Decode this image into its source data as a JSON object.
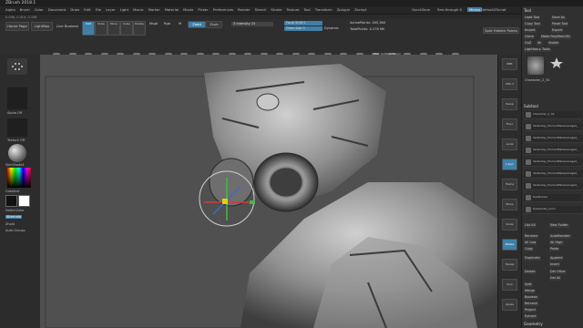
{
  "app": {
    "title": "ZBrush 2018.1"
  },
  "menu": [
    "Alpha",
    "Brush",
    "Color",
    "Document",
    "Draw",
    "Edit",
    "File",
    "Layer",
    "Light",
    "Macro",
    "Marker",
    "Material",
    "Movie",
    "Picker",
    "Preferences",
    "Render",
    "Stencil",
    "Stroke",
    "Texture",
    "Tool",
    "Transform",
    "Zplugin",
    "Zscript"
  ],
  "quick": {
    "quicksave": "QuickSave",
    "seethrough": "See-through 0",
    "menus": "Menus",
    "defaultscript": "DefaultZScript"
  },
  "status": "0.056, 0.414, 0.108",
  "toolbar": {
    "homepage": "Home Page",
    "lightbox": "LightBox",
    "livebool": "Live Boolean",
    "modes": [
      "Edit",
      "Draw",
      "Move",
      "Scale",
      "Rotate"
    ],
    "zadd": "Zadd",
    "zsub": "Zsub",
    "zintensity": "Z Intensity 25",
    "rgb": "Rgb",
    "mrgb": "Mrgb",
    "m": "M",
    "focal": "Focal Shift 0",
    "drawsize": "Draw Size 5",
    "dynamic": "Dynamic",
    "activepoints": "ActivePoints: 165,360",
    "totalpoints": "TotalPoints: 4.276 Mil",
    "splithidden": "Split Hidden Points",
    "polish": "Pant_Surface_Fabric"
  },
  "left": {
    "alphaoff": "Alpha Off",
    "textureoff": "Texture Off",
    "material": "SkinShade4",
    "gradient": "Gradient",
    "switchcolor": "SwitchColor",
    "alternate": "Alternate",
    "zhold": "Zhold",
    "autogroups": "Auto Groups"
  },
  "rightshelf": [
    "BPR",
    "SPix 3",
    "Persp",
    "Floor",
    "Local",
    "L.Sym",
    "Frame",
    "Move",
    "Scale",
    "Rotate",
    "Transp",
    "Solo",
    "Xpose"
  ],
  "tray": {
    "title": "Tool",
    "loadtool": "Load Tool",
    "saveas": "Save As",
    "copytool": "Copy Tool",
    "pastetool": "Paste Tool",
    "import": "Import",
    "export": "Export",
    "clone": "Clone",
    "makepolymesh": "Make PolyMesh3D",
    "goz": "GoZ",
    "all": "All",
    "visible": "Visible",
    "lightbox": "Lightbox ▸ Tools",
    "current": "Character_2_32",
    "subtool": "Subtool",
    "subtools": [
      "Character_2_32",
      "Yesterday_HumanMaleAverage2_",
      "Yesterday_HumanMaleAverage2_",
      "Yesterday_HumanMaleAverage2_",
      "Yesterday_HumanMaleAverage2_",
      "Yesterday_HumanMaleAverage2_",
      "Yesterday_HumanMaleAverage2_",
      "EyeShader",
      "Eyeshader_Color"
    ],
    "listall": "List All",
    "newfolder": "New Folder",
    "rename": "Rename",
    "autoreorder": "AutoReorder",
    "alllow": "All Low",
    "allhigh": "All High",
    "copy": "Copy",
    "paste": "Paste",
    "duplicate": "Duplicate",
    "append": "Append",
    "insert": "Insert",
    "delete": "Delete",
    "delother": "Del Other",
    "delall": "Del All",
    "split": "Split",
    "merge": "Merge",
    "boolean": "Boolean",
    "remesh": "Remesh",
    "project": "Project",
    "extract": "Extract",
    "geometry": "Geometry"
  }
}
